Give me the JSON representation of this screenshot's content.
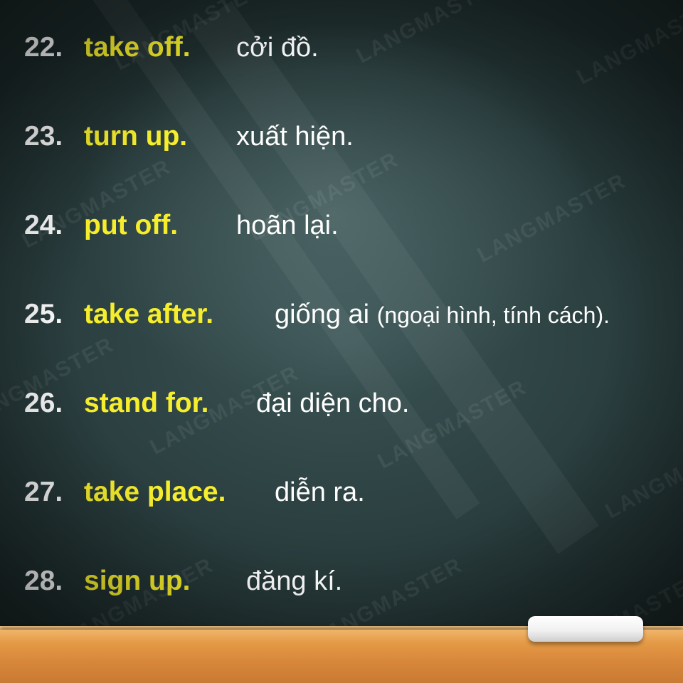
{
  "watermark": "LANGMASTER",
  "colors": {
    "number": "#ffffff",
    "phrase": "#f6ee2c",
    "meaning": "#ffffff",
    "board": "#2f4546",
    "ledge": "#e49a46"
  },
  "items": [
    {
      "num": "22.",
      "phrase": "take off.",
      "meaning": "cởi đồ."
    },
    {
      "num": "23.",
      "phrase": "turn up.",
      "meaning": "xuất hiện."
    },
    {
      "num": "24.",
      "phrase": "put off.",
      "meaning": "hoãn lại."
    },
    {
      "num": "25.",
      "phrase": "take after.",
      "meaning": "giống ai",
      "meaning_note": "(ngoại hình, tính cách)."
    },
    {
      "num": "26.",
      "phrase": "stand for.",
      "meaning": "đại diện cho."
    },
    {
      "num": "27.",
      "phrase": "take place.",
      "meaning": "diễn ra."
    },
    {
      "num": "28.",
      "phrase": "sign up.",
      "meaning": "đăng kí."
    }
  ]
}
